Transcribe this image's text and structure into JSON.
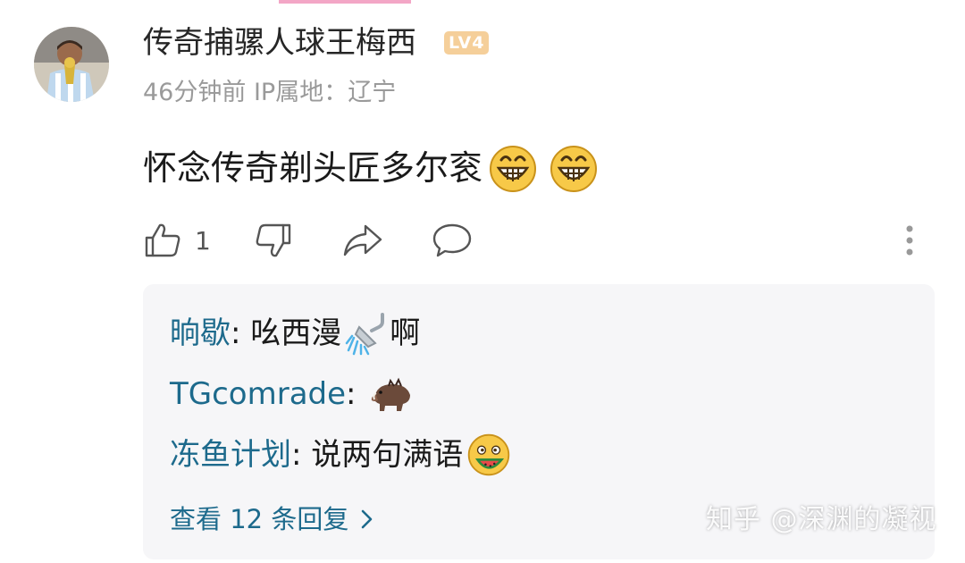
{
  "comment": {
    "username": "传奇捕骡人球王梅西",
    "level_badge": "LV4",
    "time": "46分钟前",
    "ip_location": "IP属地：辽宁",
    "text": "怀念传奇剃头匠多尔衮",
    "emojis": [
      "grinning-emoji",
      "grinning-emoji"
    ],
    "likes": "1"
  },
  "actions": {
    "icons": [
      "thumbs-up-icon",
      "thumbs-down-icon",
      "share-icon",
      "reply-icon",
      "more-icon"
    ]
  },
  "replies": [
    {
      "name": "晌歇",
      "sep": ": ",
      "text": "吆西漫",
      "after_emoji_text": "啊",
      "emoji": "shower-emoji"
    },
    {
      "name": "TGcomrade",
      "sep": ": ",
      "text": "",
      "after_emoji_text": "",
      "emoji": "boar-emoji"
    },
    {
      "name": "冻鱼计划",
      "sep": ": ",
      "text": "说两句满语",
      "after_emoji_text": "",
      "emoji": "watermelon-face-emoji"
    }
  ],
  "view_more": "查看 12 条回复",
  "watermark": "知乎 @深渊的凝视",
  "colors": {
    "link": "#1d6a8c",
    "meta_gray": "#9a9a9a",
    "level_badge": "#f5cf9a",
    "reply_bg": "#f6f6f8"
  }
}
